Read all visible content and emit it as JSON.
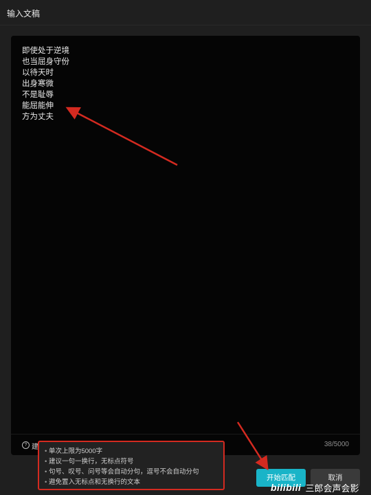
{
  "window": {
    "title": "输入文稿"
  },
  "editor": {
    "lines": [
      "即使处于逆境",
      "也当屈身守份",
      "以待天时",
      "出身寒微",
      "不是耻辱",
      "能屈能伸",
      "方为丈夫"
    ],
    "help_label": "建",
    "counter": "38/5000"
  },
  "tooltip": {
    "items": [
      "单次上限为5000字",
      "建议一句一换行，无标点符号",
      "句号、叹号、问号等会自动分句，逗号不会自动分句",
      "避免置入无标点和无换行的文本"
    ]
  },
  "buttons": {
    "start_match": "开始匹配",
    "cancel": "取消"
  },
  "watermark": {
    "logo": "bilibili",
    "text": "三郎会声会影"
  },
  "colors": {
    "accent": "#19b4c8",
    "annotation": "#d42a20"
  },
  "icons": [
    "question-icon"
  ]
}
